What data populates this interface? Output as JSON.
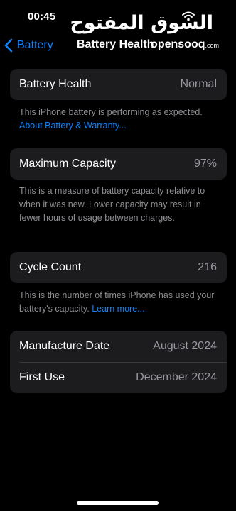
{
  "status_bar": {
    "time": "00:45"
  },
  "watermark": {
    "arabic": "السوق المفتوح",
    "latin": "opensooq",
    "suffix": ".com"
  },
  "nav": {
    "back_label": "Battery",
    "title": "Battery Health"
  },
  "battery_health": {
    "label": "Battery Health",
    "value": "Normal",
    "footnote": "This iPhone battery is performing as expected.",
    "link": "About Battery & Warranty..."
  },
  "maximum_capacity": {
    "label": "Maximum Capacity",
    "value": "97%",
    "footnote": "This is a measure of battery capacity relative to when it was new. Lower capacity may result in fewer hours of usage between charges."
  },
  "cycle_count": {
    "label": "Cycle Count",
    "value": "216",
    "footnote": "This is the number of times iPhone has used your battery's capacity.",
    "link": "Learn more..."
  },
  "dates": {
    "manufacture_label": "Manufacture Date",
    "manufacture_value": "August 2024",
    "first_use_label": "First Use",
    "first_use_value": "December 2024"
  },
  "colors": {
    "background": "#000000",
    "card": "#1c1c1e",
    "accent": "#0a84ff",
    "secondary_text": "#8e8e93"
  }
}
